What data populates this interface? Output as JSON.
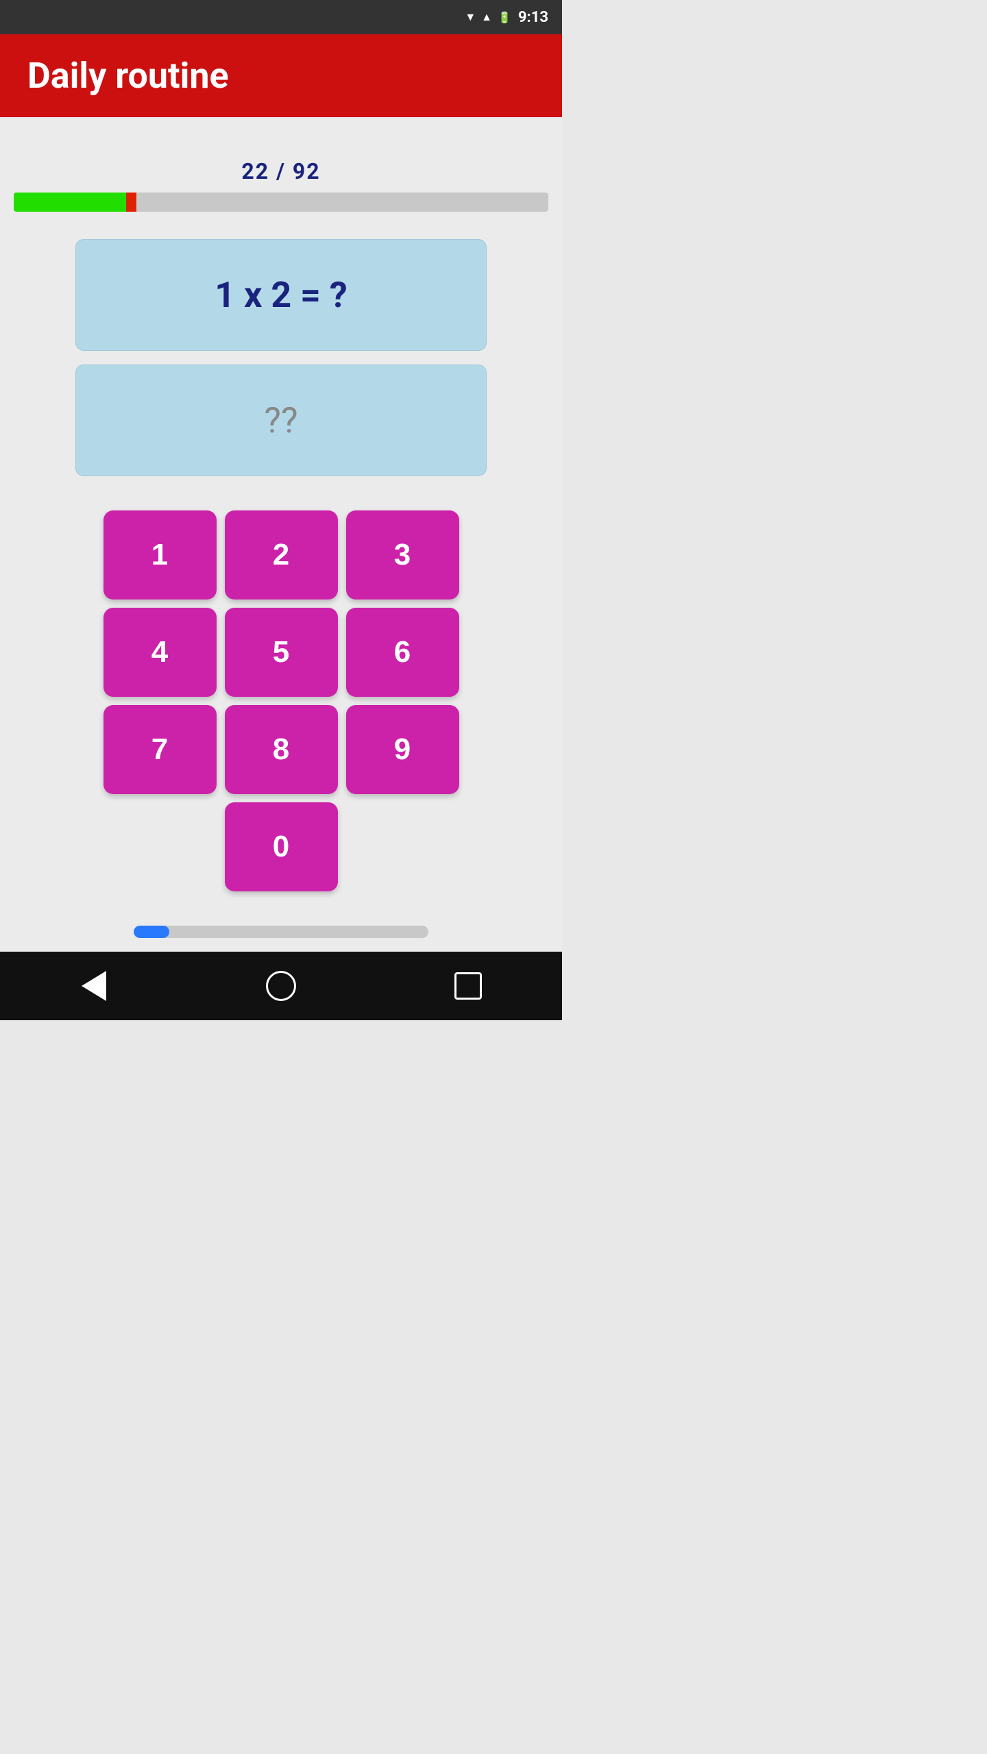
{
  "status_bar": {
    "time": "9:13"
  },
  "app_bar": {
    "title": "Daily routine"
  },
  "progress": {
    "current": 22,
    "total": 92,
    "text": "22   / 92",
    "green_width_pct": 21,
    "red_width_pct": 2
  },
  "question": {
    "text": "1 x 2 = ?"
  },
  "answer": {
    "placeholder": "??"
  },
  "numpad": {
    "buttons": [
      "1",
      "2",
      "3",
      "4",
      "5",
      "6",
      "7",
      "8",
      "9",
      "0"
    ]
  },
  "bottom_progress": {
    "width_pct": 12
  },
  "nav_bar": {
    "back_label": "back",
    "home_label": "home",
    "recents_label": "recents"
  }
}
